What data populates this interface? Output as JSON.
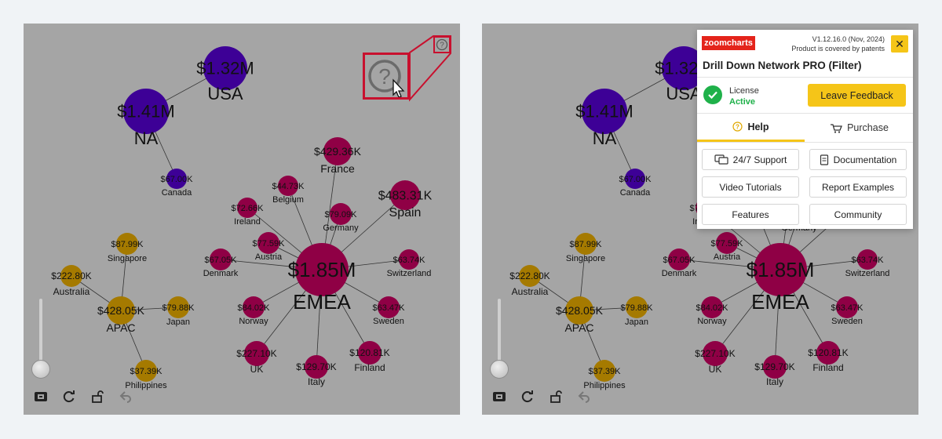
{
  "network": {
    "nodes": [
      {
        "id": "usa",
        "value": "$1.32M",
        "label": "USA"
      },
      {
        "id": "na",
        "value": "$1.41M",
        "label": "NA"
      },
      {
        "id": "canada",
        "value": "$67.00K",
        "label": "Canada"
      },
      {
        "id": "france",
        "value": "$429.36K",
        "label": "France"
      },
      {
        "id": "spain",
        "value": "$483.31K",
        "label": "Spain"
      },
      {
        "id": "belgium",
        "value": "$44.73K",
        "label": "Belgium"
      },
      {
        "id": "ireland",
        "value": "$72.66K",
        "label": "Ireland"
      },
      {
        "id": "germany",
        "value": "$79.09K",
        "label": "Germany"
      },
      {
        "id": "austria",
        "value": "$77.59K",
        "label": "Austria"
      },
      {
        "id": "denmark",
        "value": "$67.05K",
        "label": "Denmark"
      },
      {
        "id": "emea",
        "value": "$1.85M",
        "label": "EMEA"
      },
      {
        "id": "switzerland",
        "value": "$63.74K",
        "label": "Switzerland"
      },
      {
        "id": "norway",
        "value": "$84.02K",
        "label": "Norway"
      },
      {
        "id": "sweden",
        "value": "$63.47K",
        "label": "Sweden"
      },
      {
        "id": "uk",
        "value": "$227.10K",
        "label": "UK"
      },
      {
        "id": "italy",
        "value": "$129.70K",
        "label": "Italy"
      },
      {
        "id": "finland",
        "value": "$120.81K",
        "label": "Finland"
      },
      {
        "id": "singapore",
        "value": "$87.99K",
        "label": "Singapore"
      },
      {
        "id": "australia",
        "value": "$222.80K",
        "label": "Australia"
      },
      {
        "id": "apac",
        "value": "$428.05K",
        "label": "APAC"
      },
      {
        "id": "japan",
        "value": "$79.88K",
        "label": "Japan"
      },
      {
        "id": "philippines",
        "value": "$37.39K",
        "label": "Philippines"
      }
    ]
  },
  "colors": {
    "na": "#3d0096",
    "emea": "#8f0045",
    "apac": "#a57a00",
    "panel_bg": "#a5a5a5",
    "accent": "#f5c518",
    "highlight": "#c8102e",
    "license_green": "#1fb14a"
  },
  "toolbar_icons": [
    "fit-to-screen-icon",
    "refresh-icon",
    "unlock-icon",
    "back-icon"
  ],
  "popup": {
    "logo": "zoomcharts",
    "version": "V1.12.16.0 (Nov, 2024)",
    "patent": "Product is covered by patents",
    "close": "✕",
    "title": "Drill Down Network PRO (Filter)",
    "license_label": "License",
    "license_status": "Active",
    "feedback": "Leave Feedback",
    "tabs": {
      "help": "Help",
      "purchase": "Purchase"
    },
    "buttons": {
      "support": "24/7 Support",
      "documentation": "Documentation",
      "video": "Video Tutorials",
      "report": "Report Examples",
      "features": "Features",
      "community": "Community"
    }
  }
}
